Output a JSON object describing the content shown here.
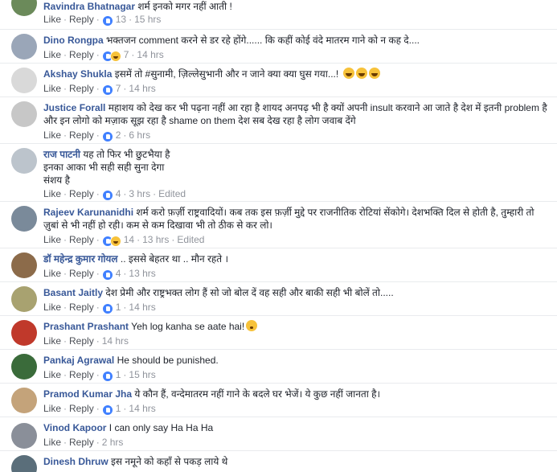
{
  "comments": [
    {
      "author": "Ravindra Bhatnagar",
      "text": "शर्म इनको मगर नहीं आती !",
      "like": "Like",
      "reply": "Reply",
      "reactions": "13",
      "time": "15 hrs",
      "edited": ""
    },
    {
      "author": "Dino Rongpa",
      "text": "भक्तजन comment करने से डर रहे होंगे...... कि कहीं कोई वंदे मातरम गाने को न कह दे....",
      "like": "Like",
      "reply": "Reply",
      "reactions": "7",
      "time": "14 hrs",
      "edited": ""
    },
    {
      "author": "Akshay Shukla",
      "text": "इसमें तो #सुनामी, ज़िल्लेसुभानी और न जाने क्या क्या घुस गया...!",
      "like": "Like",
      "reply": "Reply",
      "reactions": "7",
      "time": "14 hrs",
      "edited": ""
    },
    {
      "author": "Justice Forall",
      "text": "महाशय को देख कर भी पढ़ना नहीं आ रहा है शायद अनपढ़ भी है क्यों अपनी insult करवाने आ जाते है देश में इतनी problem है और इन लोगो को मज़ाक सूझ रहा है shame on them देश सब देख रहा है लोग जवाब देंगे",
      "like": "Like",
      "reply": "Reply",
      "reactions": "2",
      "time": "6 hrs",
      "edited": ""
    },
    {
      "author": "राज पाटनी",
      "text": "यह तो फिर भी छुटभैया है",
      "text2": "इनका आका भी सही सही सुना देगा",
      "text3": "संशय है",
      "like": "Like",
      "reply": "Reply",
      "reactions": "4",
      "time": "3 hrs",
      "edited": "Edited"
    },
    {
      "author": "Rajeev Karunanidhi",
      "text": "शर्म करो फ़र्ज़ी राष्ट्रवादियों। कब तक इस फ़र्ज़ी मुद्दे पर राजनीतिक रोटियां सेंकोगे। देशभक्ति दिल से होती है, तुम्हारी तो ज़ुबां से भी नहीं हो रही। कम से कम दिखावा भी तो ठीक से कर लो।",
      "like": "Like",
      "reply": "Reply",
      "reactions": "14",
      "time": "13 hrs",
      "edited": "Edited"
    },
    {
      "author": "डॉ महेन्द्र कुमार गोयल",
      "text": ".. इससे बेहतर था .. मौन रहते ।",
      "like": "Like",
      "reply": "Reply",
      "reactions": "4",
      "time": "13 hrs",
      "edited": ""
    },
    {
      "author": "Basant Jaitly",
      "text": "देश प्रेमी और राष्ट्रभक्त लोग हैं सो जो बोल दें वह सही और बाकी सही भी बोलें तो.....",
      "like": "Like",
      "reply": "Reply",
      "reactions": "1",
      "time": "14 hrs",
      "edited": ""
    },
    {
      "author": "Prashant Prashant",
      "text": "Yeh log kanha se aate hai!",
      "like": "Like",
      "reply": "Reply",
      "reactions": "",
      "time": "14 hrs",
      "edited": ""
    },
    {
      "author": "Pankaj Agrawal",
      "text": "He should be punished.",
      "like": "Like",
      "reply": "Reply",
      "reactions": "1",
      "time": "15 hrs",
      "edited": ""
    },
    {
      "author": "Pramod Kumar Jha",
      "text": "ये कौन हैं, वन्देमातरम नहीं गाने के बदले घर भेजें। ये कुछ नहीं जानता है।",
      "like": "Like",
      "reply": "Reply",
      "reactions": "1",
      "time": "14 hrs",
      "edited": ""
    },
    {
      "author": "Vinod Kapoor",
      "text": "I can only say Ha Ha Ha",
      "like": "Like",
      "reply": "Reply",
      "reactions": "",
      "time": "2 hrs",
      "edited": ""
    },
    {
      "author": "Dinesh Dhruw",
      "text": "इस नमूने को कहाँ से पकड़ लाये थे",
      "like": "",
      "reply": "",
      "reactions": "",
      "time": "",
      "edited": ""
    }
  ],
  "avatar_colors": [
    "#6b8a5a",
    "#9aa6b8",
    "#d9d9d9",
    "#c7c7c7",
    "#bcc4cc",
    "#7a8a9a",
    "#8c6b4a",
    "#a8a270",
    "#c0392b",
    "#3a6b3a",
    "#c4a37a",
    "#8a8f99",
    "#5a6e7a"
  ],
  "accent": "#385898"
}
